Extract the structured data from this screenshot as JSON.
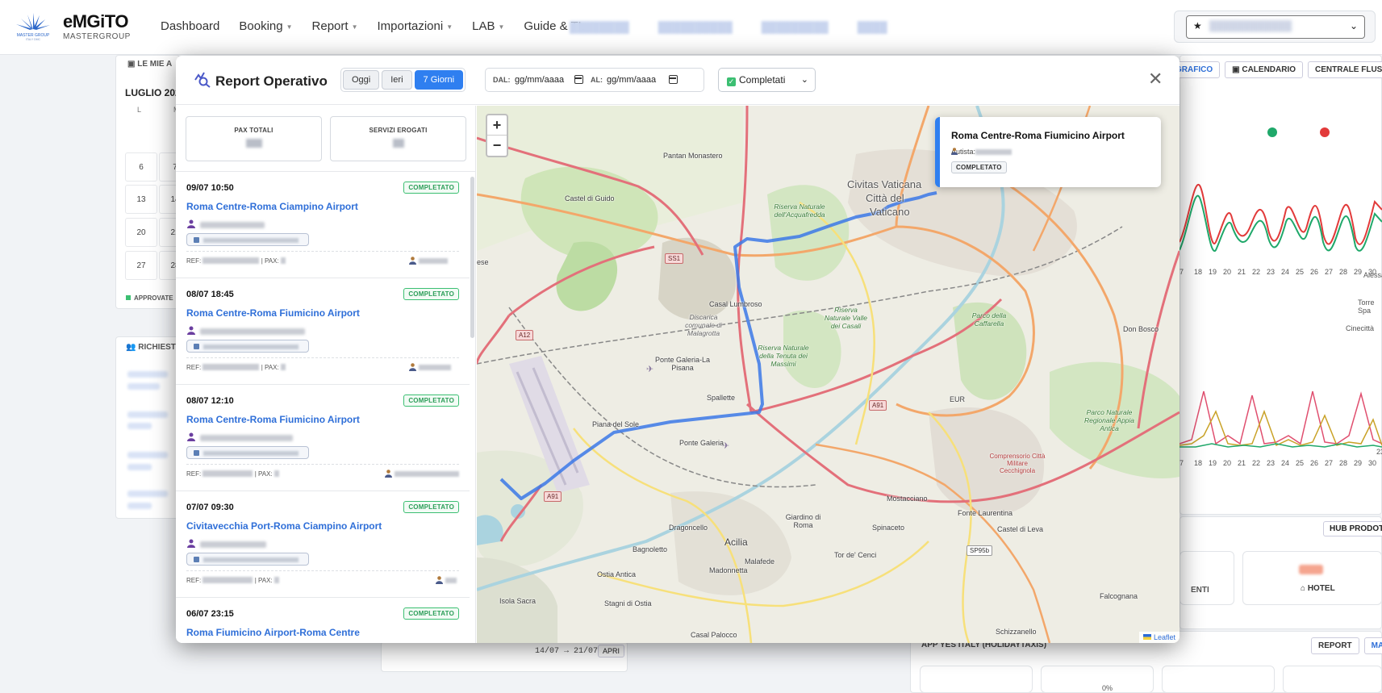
{
  "app": {
    "brand": "eMGiTO",
    "brand_sub": "MASTERGROUP",
    "logo_text": "MASTER GROUP ITALY DMC"
  },
  "nav": {
    "items": [
      "Dashboard",
      "Booking",
      "Report",
      "Importazioni",
      "LAB",
      "Guide & TL"
    ],
    "caret_items": [
      1,
      2,
      3,
      4
    ]
  },
  "favorites": {
    "star": "★",
    "chevron": "⌄"
  },
  "background": {
    "calendar_title": "LE MIE A",
    "month": "LUGLIO 202",
    "weekdays": [
      "L",
      "M"
    ],
    "week_rows": [
      [
        "6",
        "7"
      ],
      [
        "13",
        "14"
      ],
      [
        "20",
        "21"
      ],
      [
        "27",
        "28"
      ]
    ],
    "legend": "APPROVATE",
    "requests_title": "RICHIEST",
    "right_buttons": [
      "GRAFICO",
      "CALENDARIO",
      "CENTRALE FLUS"
    ],
    "x_ticks": [
      "7",
      "18",
      "19",
      "20",
      "21",
      "22",
      "23",
      "24",
      "25",
      "26",
      "27",
      "28",
      "29",
      "30"
    ],
    "x_ticks2": [
      "7",
      "18",
      "19",
      "20",
      "21",
      "22",
      "23",
      "24",
      "25",
      "26",
      "27",
      "28",
      "29",
      "30"
    ],
    "side_labels": [
      "Alessa",
      "Torre Spa",
      "Cinecittà",
      "23"
    ],
    "hub_button": "HUB PRODOTT",
    "hotel_label": "HOTEL",
    "enti_label": "ENTI",
    "pct": "0%",
    "app_section": "APP YES ITALY (HOLIDAYTAXIS)",
    "report_buttons": [
      "REPORT",
      "MAP"
    ],
    "under_dates": "14/07 → 21/07",
    "under_apri": "APRI"
  },
  "modal": {
    "title": "Report Operativo",
    "periods": [
      {
        "label": "Oggi",
        "active": false
      },
      {
        "label": "Ieri",
        "active": false
      },
      {
        "label": "7 Giorni",
        "active": true
      }
    ],
    "from_label": "DAL:",
    "from_value": "gg/mm/aaaa",
    "to_label": "AL:",
    "to_value": "gg/mm/aaaa",
    "status_filter": "Completati",
    "check": "✓",
    "chevron": "⌄",
    "close": "✕",
    "stats": [
      {
        "label": "PAX TOTALI"
      },
      {
        "label": "SERVIZI EROGATI"
      }
    ],
    "services": [
      {
        "datetime": "09/07 10:50",
        "status": "COMPLETATO",
        "route": "Roma Centre-Roma Ciampino Airport",
        "ref_label": "REF:",
        "pax_label": "| PAX:"
      },
      {
        "datetime": "08/07 18:45",
        "status": "COMPLETATO",
        "route": "Roma Centre-Roma Fiumicino Airport",
        "ref_label": "REF:",
        "pax_label": "| PAX:"
      },
      {
        "datetime": "08/07 12:10",
        "status": "COMPLETATO",
        "route": "Roma Centre-Roma Fiumicino Airport",
        "ref_label": "REF:",
        "pax_label": "| PAX:"
      },
      {
        "datetime": "07/07 09:30",
        "status": "COMPLETATO",
        "route": "Civitavecchia Port-Roma Ciampino Airport",
        "ref_label": "REF:",
        "pax_label": "| PAX:"
      },
      {
        "datetime": "06/07 23:15",
        "status": "COMPLETATO",
        "route": "Roma Fiumicino Airport-Roma Centre",
        "ref_label": "REF:",
        "pax_label": "| PAX:"
      }
    ]
  },
  "map": {
    "zoom_in": "+",
    "zoom_out": "−",
    "popup": {
      "title": "Roma Centre-Roma Fiumicino Airport",
      "driver_label": "Autista:",
      "status": "COMPLETATO"
    },
    "attribution": "Leaflet",
    "labels": {
      "pantan": "Pantan Monastero",
      "castel": "Castel di Guido",
      "civitas": "Civitas Vaticana",
      "citta": "Città del",
      "vaticano": "Vaticano",
      "riserva_acqua": "Riserva Naturale dell'Acquafredda",
      "casal": "Casal Lumbroso",
      "discarica": "Discarica comunale di Malagrotta",
      "riserva_valle": "Riserva Naturale Valle dei Casali",
      "parco_caff": "Parco della Caffarella",
      "donbosco": "Don Bosco",
      "ponte_galeria_pisana": "Ponte Galeria-La Pisana",
      "riserva_tenuta": "Riserva Naturale della Tenuta dei Massimi",
      "spallette": "Spallette",
      "eur": "EUR",
      "parco_appia": "Parco Naturale Regionale Appia Antica",
      "piana": "Piana del Sole",
      "ponte_galeria": "Ponte Galeria",
      "comprensorio": "Comprensorio Città Militare Cecchignola",
      "mostacciano": "Mostacciano",
      "fonte": "Fonte Laurentina",
      "giardino": "Giardino di Roma",
      "dragoncello": "Dragoncello",
      "spinaceto": "Spinaceto",
      "castel_leva": "Castel di Leva",
      "bagnoletto": "Bagnoletto",
      "acilia": "Acilia",
      "malafede": "Malafede",
      "tordecenci": "Tor de' Cenci",
      "ostia": "Ostia Antica",
      "madonnetta": "Madonnetta",
      "isola": "Isola Sacra",
      "stagni": "Stagni di Ostia",
      "casalpalocco": "Casal Palocco",
      "falcognana": "Falcognana",
      "schizzanello": "Schizzanello",
      "ese": "ese",
      "ss1": "SS1",
      "a12": "A12",
      "a91": "A91",
      "a91b": "A91",
      "sp95b": "SP95b"
    }
  }
}
